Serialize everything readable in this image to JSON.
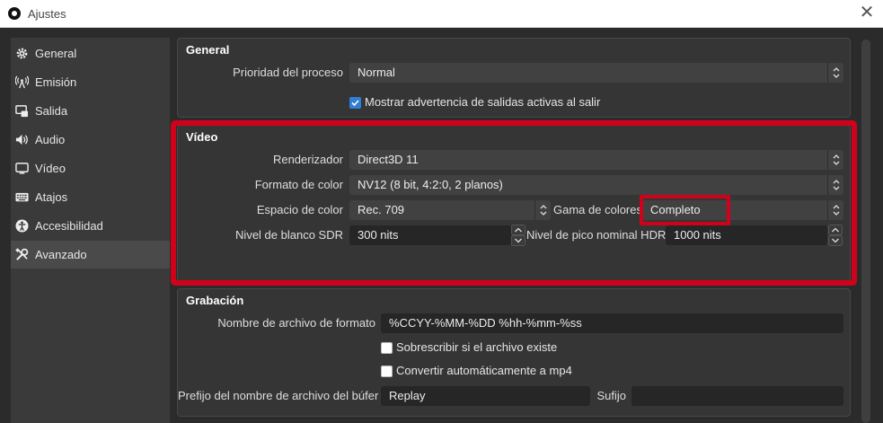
{
  "window": {
    "title": "Ajustes"
  },
  "sidebar": {
    "items": [
      {
        "label": "General",
        "icon": "gear-icon"
      },
      {
        "label": "Emisión",
        "icon": "broadcast-icon"
      },
      {
        "label": "Salida",
        "icon": "output-icon"
      },
      {
        "label": "Audio",
        "icon": "speaker-icon"
      },
      {
        "label": "Vídeo",
        "icon": "monitor-icon"
      },
      {
        "label": "Atajos",
        "icon": "keyboard-icon"
      },
      {
        "label": "Accesibilidad",
        "icon": "accessibility-icon"
      },
      {
        "label": "Avanzado",
        "icon": "tools-icon"
      }
    ],
    "active": "Avanzado"
  },
  "general": {
    "title": "General",
    "priority_label": "Prioridad del proceso",
    "priority_value": "Normal",
    "warn_label": "Mostrar advertencia de salidas activas al salir",
    "warn_checked": true
  },
  "video": {
    "title": "Vídeo",
    "renderer_label": "Renderizador",
    "renderer_value": "Direct3D 11",
    "color_format_label": "Formato de color",
    "color_format_value": "NV12 (8 bit, 4:2:0, 2 planos)",
    "color_space_label": "Espacio de color",
    "color_space_value": "Rec. 709",
    "color_range_label": "Gama de colores",
    "color_range_value": "Completo",
    "sdr_label": "Nivel de blanco SDR",
    "sdr_value": "300 nits",
    "hdr_label": "Nivel de pico nominal HDR",
    "hdr_value": "1000 nits"
  },
  "recording": {
    "title": "Grabación",
    "filename_label": "Nombre de archivo de formato",
    "filename_value": "%CCYY-%MM-%DD %hh-%mm-%ss",
    "overwrite_label": "Sobrescribir si el archivo existe",
    "overwrite_checked": false,
    "remux_label": "Convertir automáticamente a mp4",
    "remux_checked": false,
    "buffer_prefix_label": "Prefijo del nombre de archivo del búfer",
    "buffer_prefix_value": "Replay",
    "suffix_label": "Sufijo",
    "suffix_value": ""
  },
  "colors": {
    "highlight": "#d0021b",
    "checkbox_on": "#2f7fd6",
    "background": "#2b2b2b"
  }
}
